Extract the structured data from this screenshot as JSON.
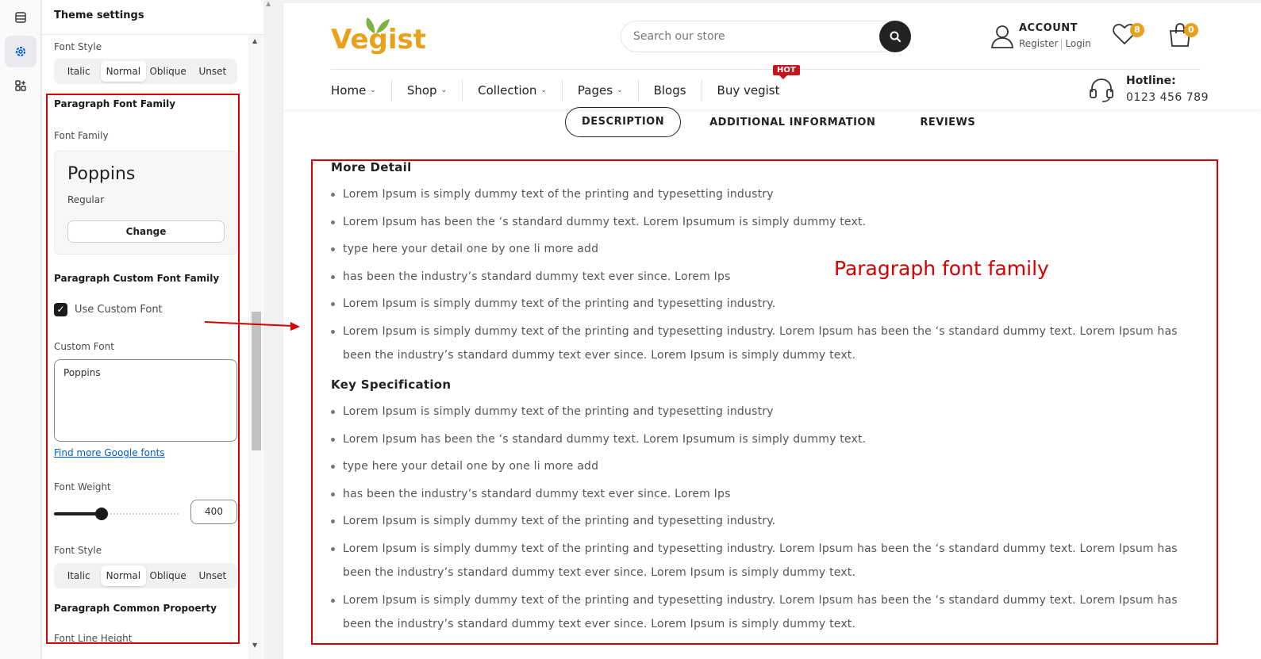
{
  "colors": {
    "accent": "#e8a11b",
    "annotation": "#d60000",
    "hot_badge": "#c4161c"
  },
  "rail": {
    "icons": [
      "list-icon",
      "gear-icon",
      "apps-icon"
    ]
  },
  "panel": {
    "title": "Theme settings",
    "font_style_top": {
      "label": "Font Style",
      "options": [
        "Italic",
        "Normal",
        "Oblique",
        "Unset"
      ],
      "selected": "Normal"
    },
    "paragraph_font_family_heading": "Paragraph Font Family",
    "font_family_label": "Font Family",
    "font_card": {
      "name": "Poppins",
      "variant": "Regular",
      "change_label": "Change"
    },
    "custom_font_heading": "Paragraph Custom Font Family",
    "use_custom_font": {
      "label": "Use Custom Font",
      "checked": true
    },
    "custom_font_label": "Custom Font",
    "custom_font_value": "Poppins",
    "google_fonts_link": "Find more Google fonts",
    "font_weight": {
      "label": "Font Weight",
      "value": "400"
    },
    "font_style_bottom": {
      "label": "Font Style",
      "options": [
        "Italic",
        "Normal",
        "Oblique",
        "Unset"
      ],
      "selected": "Normal"
    },
    "common_property_heading": "Paragraph Common Propoerty",
    "line_height_label": "Font Line Height"
  },
  "store": {
    "logo": "Vegist",
    "search_placeholder": "Search our store",
    "account": {
      "title": "ACCOUNT",
      "register": "Register",
      "login": "Login"
    },
    "wishlist_count": "8",
    "cart_count": "0",
    "nav": [
      {
        "label": "Home",
        "has_caret": true
      },
      {
        "label": "Shop",
        "has_caret": true
      },
      {
        "label": "Collection",
        "has_caret": true
      },
      {
        "label": "Pages",
        "has_caret": true
      },
      {
        "label": "Blogs",
        "has_caret": false
      },
      {
        "label": "Buy vegist",
        "has_caret": false
      }
    ],
    "hot_badge": "HOT",
    "hotline": {
      "title": "Hotline:",
      "number": "0123 456 789"
    },
    "tabs": [
      "DESCRIPTION",
      "ADDITIONAL INFORMATION",
      "REVIEWS"
    ],
    "sections": [
      {
        "title": "More Detail",
        "items": [
          "Lorem Ipsum is simply dummy text of the printing and typesetting industry",
          "Lorem Ipsum has been the ‘s standard dummy text. Lorem Ipsumum is simply dummy text.",
          "type here your detail one by one li more add",
          "has been the industry’s standard dummy text ever since. Lorem Ips",
          "Lorem Ipsum is simply dummy text of the printing and typesetting industry.",
          "Lorem Ipsum is simply dummy text of the printing and typesetting industry. Lorem Ipsum has been the ‘s standard dummy text. Lorem Ipsum has been the industry’s standard dummy text ever since. Lorem Ipsum is simply dummy text."
        ]
      },
      {
        "title": "Key Specification",
        "items": [
          "Lorem Ipsum is simply dummy text of the printing and typesetting industry",
          "Lorem Ipsum has been the ‘s standard dummy text. Lorem Ipsumum is simply dummy text.",
          "type here your detail one by one li more add",
          "has been the industry’s standard dummy text ever since. Lorem Ips",
          "Lorem Ipsum is simply dummy text of the printing and typesetting industry.",
          "Lorem Ipsum is simply dummy text of the printing and typesetting industry. Lorem Ipsum has been the ‘s standard dummy text. Lorem Ipsum has been the industry’s standard dummy text ever since. Lorem Ipsum is simply dummy text.",
          "Lorem Ipsum is simply dummy text of the printing and typesetting industry. Lorem Ipsum has been the ‘s standard dummy text. Lorem Ipsum has been the industry’s standard dummy text ever since. Lorem Ipsum is simply dummy text."
        ]
      }
    ]
  },
  "annotation": "Paragraph font family"
}
